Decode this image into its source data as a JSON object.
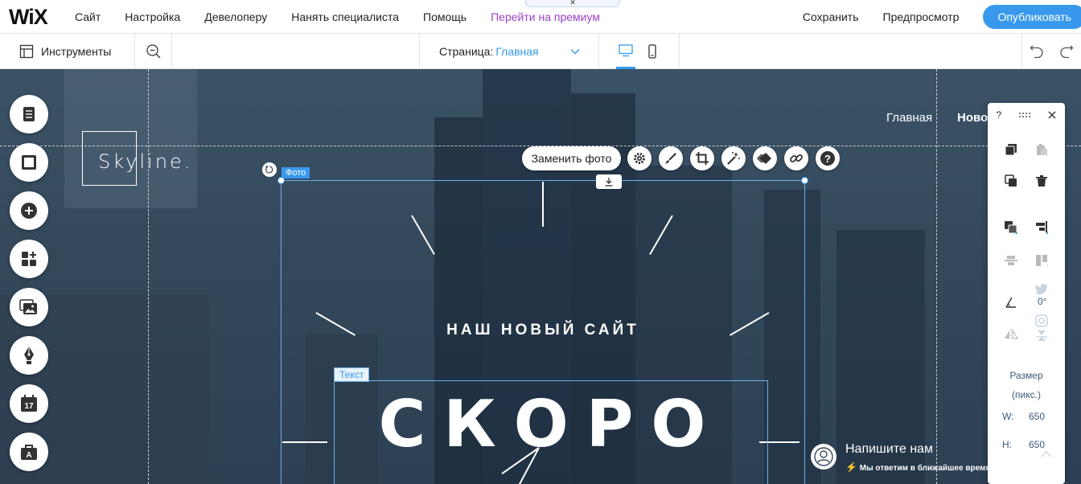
{
  "topbar": {
    "logo": "WiX",
    "menu": [
      "Сайт",
      "Настройка",
      "Девелоперу",
      "Нанять специалиста",
      "Помощь",
      "Перейти на премиум"
    ],
    "save": "Сохранить",
    "preview": "Предпросмотр",
    "publish": "Опубликовать"
  },
  "toolbar": {
    "tools_label": "Инструменты",
    "page_label": "Страница:",
    "page_value": "Главная"
  },
  "site": {
    "logo": "Skyline.",
    "nav": [
      "Главная",
      "Новости"
    ],
    "headline": "НАШ НОВЫЙ САЙТ",
    "big_text": "СКОРО",
    "chat_title": "Напишите нам",
    "chat_sub": "Мы ответим в ближайшее время"
  },
  "selection": {
    "photo_tag": "Фото",
    "text_tag": "Текст",
    "replace_photo": "Заменить фото"
  },
  "panel": {
    "help": "?",
    "angle": "0°",
    "size_label_1": "Размер",
    "size_label_2": "(пикс.)",
    "w_label": "W:",
    "w_value": "650",
    "h_label": "H:",
    "h_value": "650"
  },
  "icons": {
    "leftbar": [
      "pages-icon",
      "background-icon",
      "add-icon",
      "apps-icon",
      "media-icon",
      "blog-pen-icon",
      "bookings-calendar-icon",
      "portfolio-briefcase-icon"
    ],
    "context": [
      "settings-gear-icon",
      "design-brush-icon",
      "crop-icon",
      "enhance-wand-icon",
      "animation-icon",
      "link-icon",
      "help-icon"
    ]
  },
  "colors": {
    "accent": "#3899ec",
    "premium": "#9a3fc9"
  }
}
